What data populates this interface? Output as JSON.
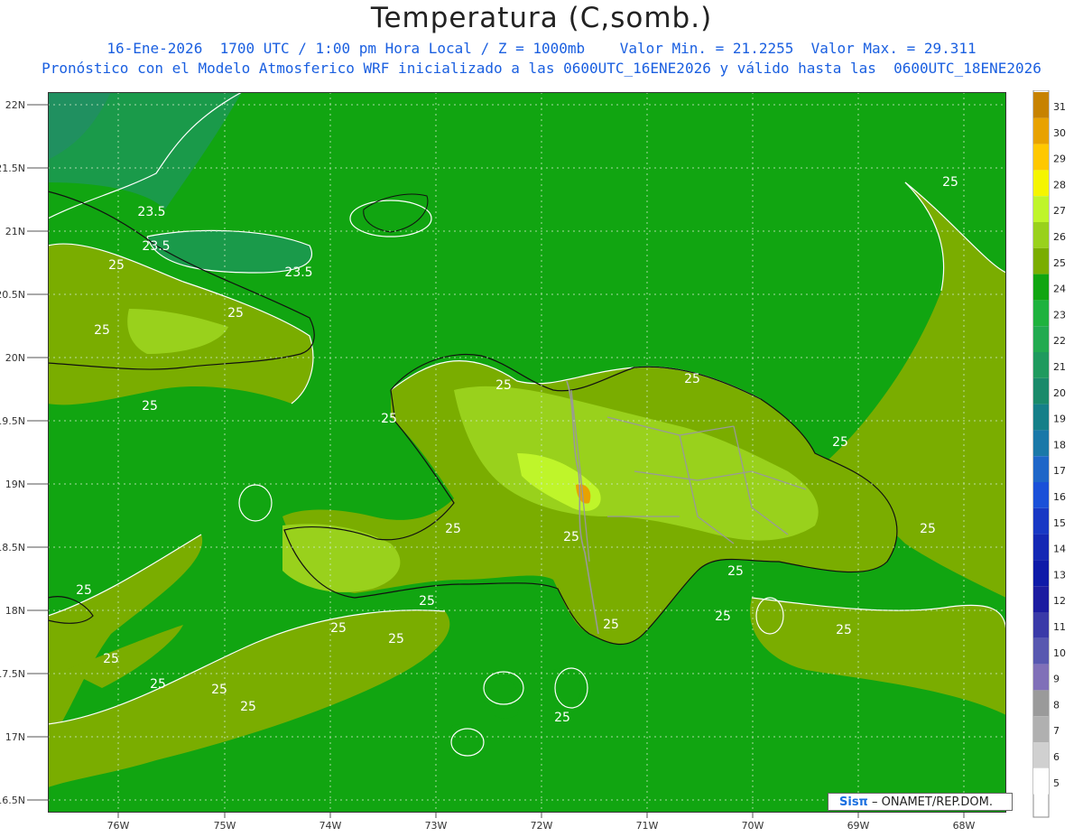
{
  "header": {
    "title": "Temperatura (C,somb.)",
    "line1": "16-Ene-2026  1700 UTC / 1:00 pm Hora Local / Z = 1000mb    Valor Min. = 21.2255  Valor Max. = 29.311",
    "line2": "Pronóstico con el Modelo Atmosferico WRF inicializado a las 0600UTC_16ENE2026 y válido hasta las  0600UTC_18ENE2026"
  },
  "axes": {
    "lat_labels": [
      "22N",
      "21.5N",
      "21N",
      "20.5N",
      "20N",
      "19.5N",
      "19N",
      "18.5N",
      "18N",
      "17.5N",
      "17N",
      "16.5N"
    ],
    "lon_labels": [
      "76W",
      "75W",
      "74W",
      "73W",
      "72W",
      "71W",
      "70W",
      "69W",
      "68W"
    ]
  },
  "colorbar": {
    "labels": [
      "31",
      "30",
      "29",
      "28",
      "27",
      "26",
      "25",
      "24",
      "23",
      "22",
      "21",
      "20",
      "19",
      "18",
      "17",
      "16",
      "15",
      "14",
      "13",
      "12",
      "11",
      "10",
      "9",
      "8",
      "7",
      "6",
      "5"
    ],
    "colors": [
      "#c78200",
      "#e8a200",
      "#ffc800",
      "#f5f500",
      "#bff52a",
      "#99d11c",
      "#7aad00",
      "#11a511",
      "#1fb23e",
      "#22aa50",
      "#1f9a5e",
      "#1a8a6a",
      "#157f88",
      "#1a78a8",
      "#1e66c8",
      "#1a50d8",
      "#1838c4",
      "#1428b4",
      "#0e1aa8",
      "#1c1ca0",
      "#3a3aa8",
      "#5858b0",
      "#8070b8",
      "#9a9a9a",
      "#b0b0b0",
      "#d0d0d0",
      "#ffffff"
    ]
  },
  "contour_labels": [
    "23.5",
    "23.5",
    "23.5",
    "25",
    "25",
    "25",
    "25",
    "25",
    "25",
    "25",
    "25",
    "25",
    "25",
    "25",
    "25",
    "25",
    "25",
    "25",
    "25",
    "25",
    "25",
    "25",
    "25",
    "25",
    "25",
    "25",
    "25",
    "25"
  ],
  "credit": {
    "brand": "Sisπ",
    "text": "– ONAMET/REP.DOM."
  }
}
